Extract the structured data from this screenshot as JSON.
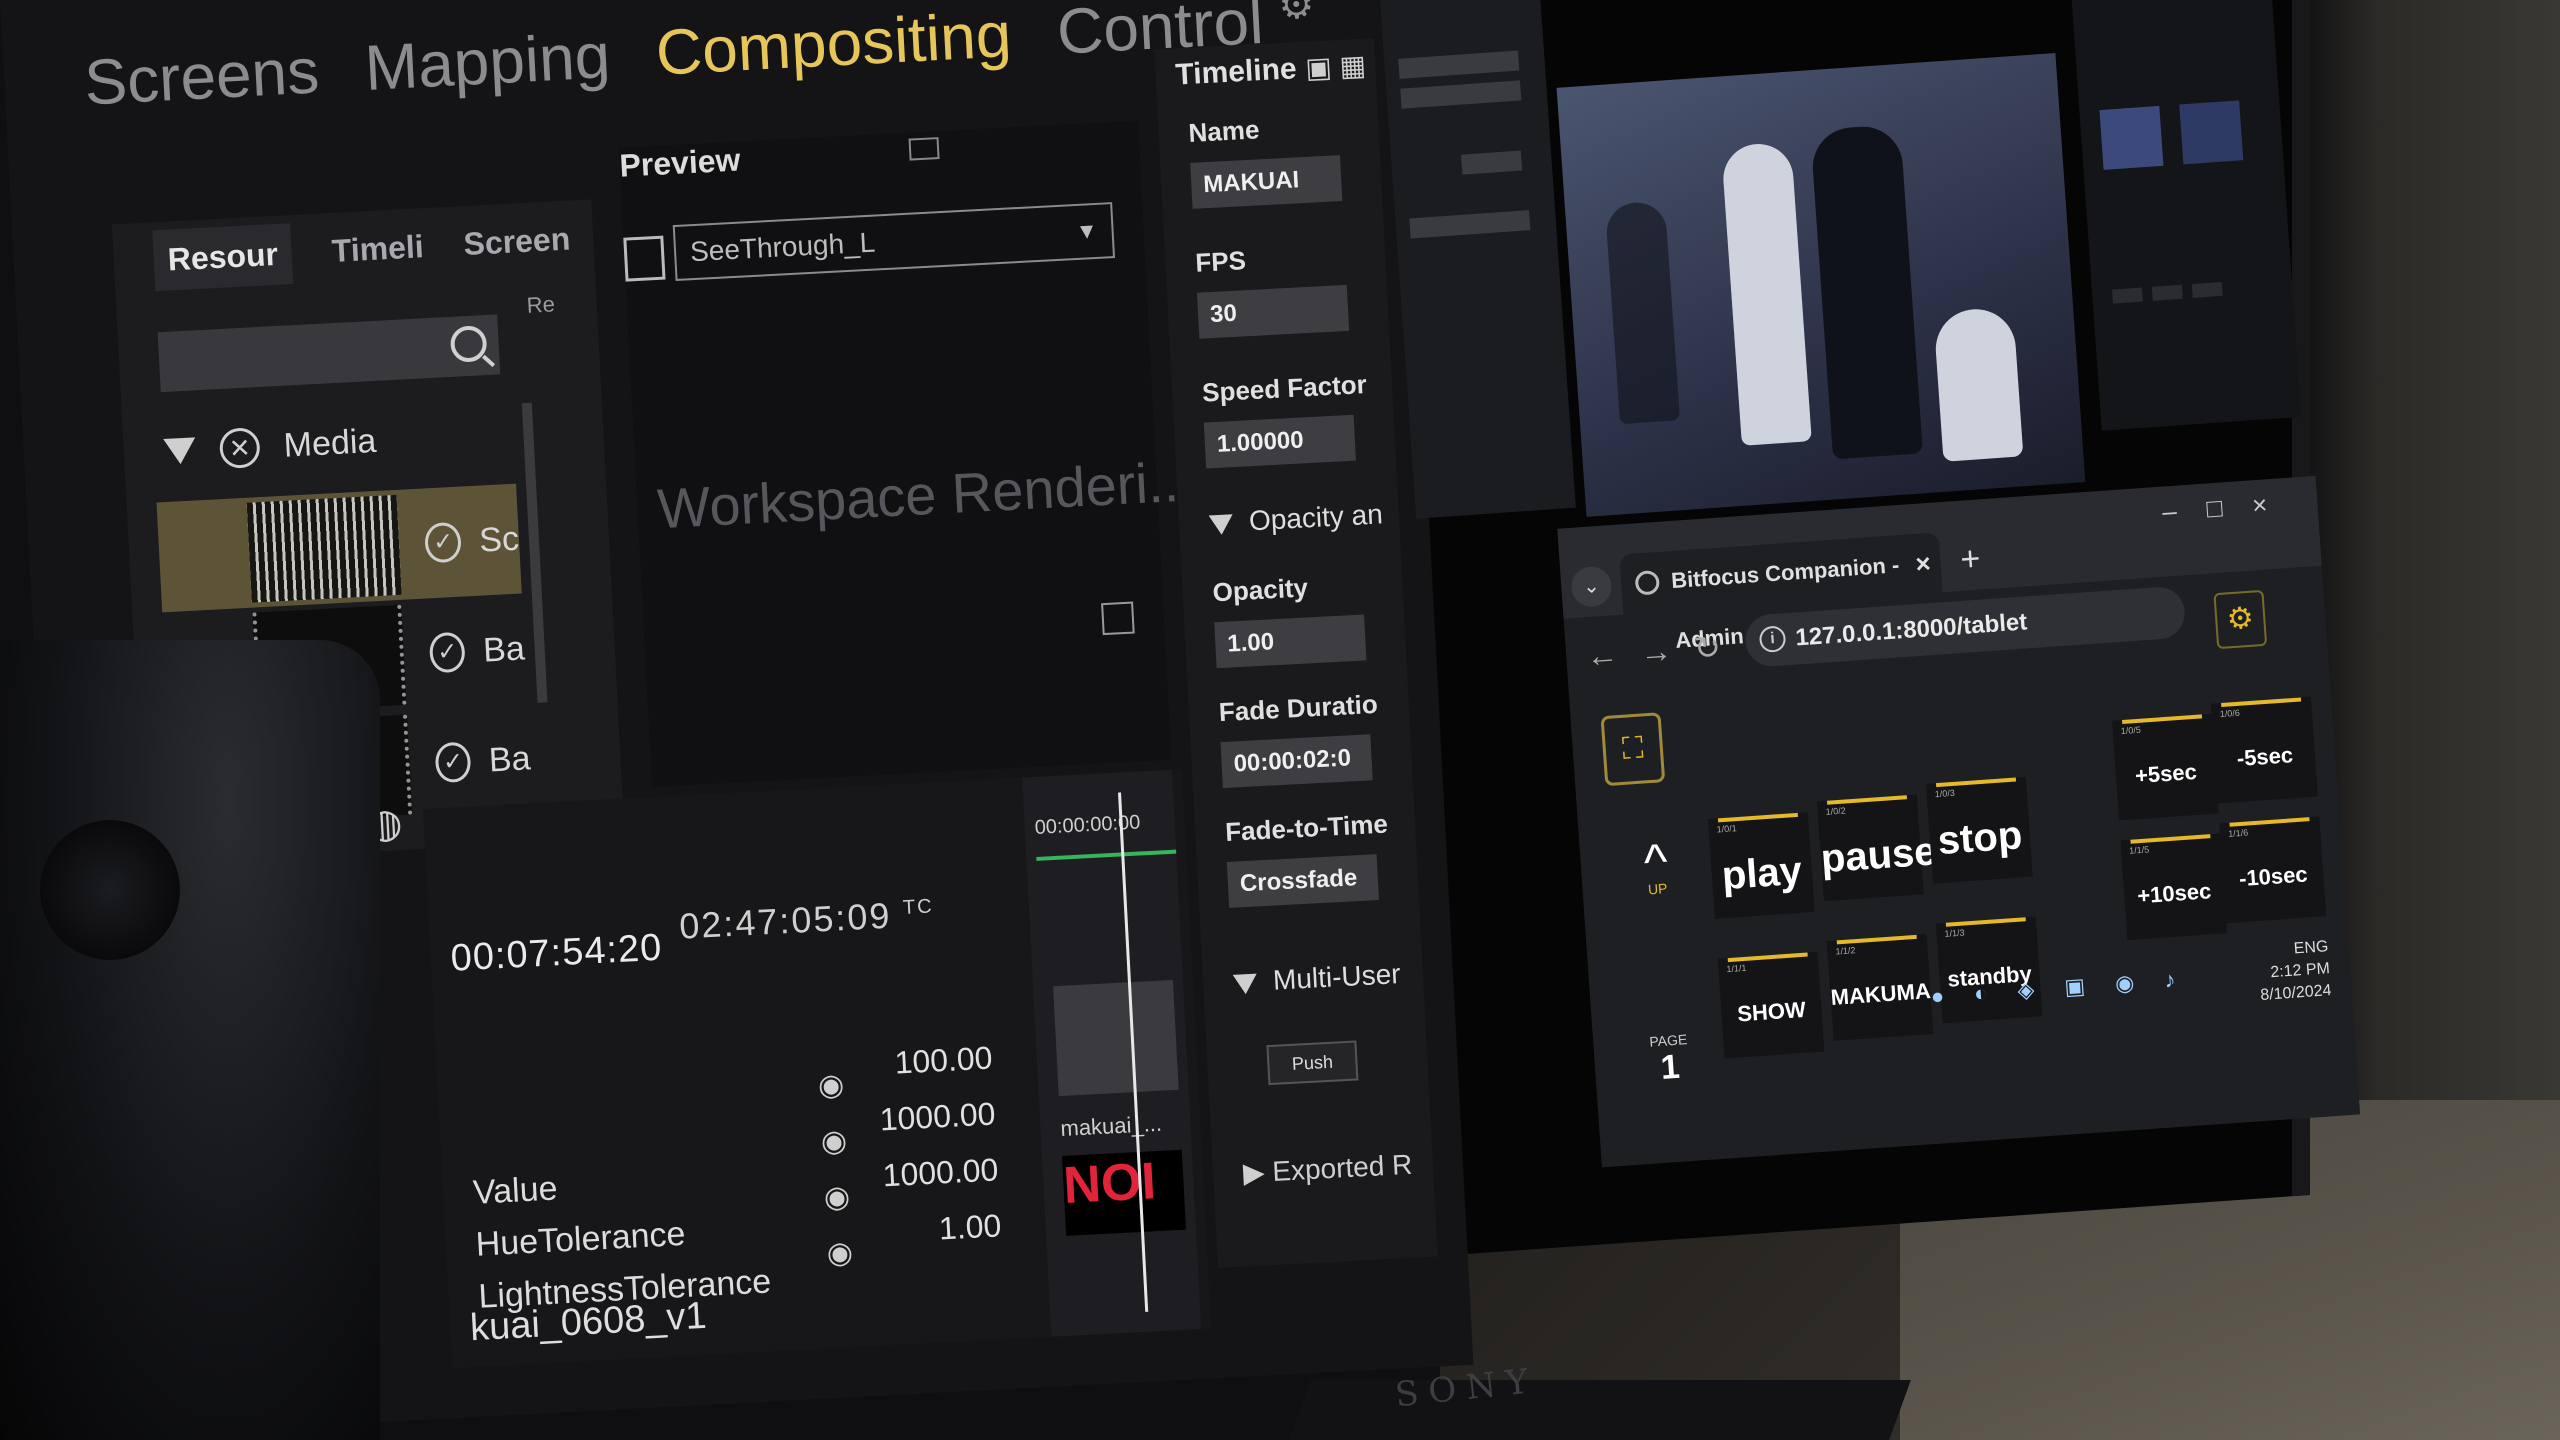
{
  "compositing_app": {
    "top_tabs": [
      "Screens",
      "Mapping",
      "Compositing",
      "Control"
    ],
    "active_tab": "Compositing",
    "sub_tabs": [
      "Resour",
      "Timeli",
      "Screen"
    ],
    "resources_stub": "Re",
    "media_folder": "Media",
    "media_items": [
      {
        "label": "Sc",
        "thumb": "Pozo"
      },
      {
        "label": "Ba"
      },
      {
        "label": "Ba"
      }
    ],
    "preview": {
      "title": "Preview",
      "selected_source": "SeeThrough_L",
      "status": "Workspace Renderi..."
    },
    "timeline": {
      "current_time": "00:07:54:20",
      "timecode": "02:47:05:09",
      "tc_label": "TC",
      "track_time": "00:00:00:00",
      "values": [
        "100.00",
        "1000.00",
        "1000.00",
        "1.00"
      ],
      "params": [
        "Value",
        "HueTolerance",
        "LightnessTolerance"
      ],
      "clip_name": "kuai_0608_v1",
      "track_clip_label": "makuai_...",
      "noi_logo": "NOI"
    },
    "properties": {
      "header": "Timeline",
      "name_label": "Name",
      "name_value": "MAKUAI",
      "fps_label": "FPS",
      "fps_value": "30",
      "speed_label": "Speed Factor",
      "speed_value": "1.00000",
      "opacity_section": "Opacity an",
      "opacity_label": "Opacity",
      "opacity_value": "1.00",
      "fade_label": "Fade Duratio",
      "fade_value": "00:00:02:0",
      "fade_to_label": "Fade-to-Time",
      "fade_to_value": "Crossfade",
      "multi_user": "Multi-User",
      "push": "Push",
      "exported": "Exported R"
    }
  },
  "companion": {
    "tab_title": "Bitfocus Companion - Admin",
    "url": "127.0.0.1:8000/tablet",
    "keys": [
      {
        "id": "play",
        "label": "play",
        "tag": "1/0/1"
      },
      {
        "id": "pause",
        "label": "pause",
        "tag": "1/0/2"
      },
      {
        "id": "stop",
        "label": "stop",
        "tag": "1/0/3"
      },
      {
        "id": "plus5",
        "label": "+5sec",
        "tag": "1/0/5"
      },
      {
        "id": "minus5",
        "label": "-5sec",
        "tag": "1/0/6"
      },
      {
        "id": "plus10",
        "label": "+10sec",
        "tag": "1/1/5"
      },
      {
        "id": "minus10",
        "label": "-10sec",
        "tag": "1/1/6"
      },
      {
        "id": "show",
        "label": "SHOW",
        "tag": "1/1/1"
      },
      {
        "id": "makuma",
        "label": "MAKUMA",
        "tag": "1/1/2"
      },
      {
        "id": "standby",
        "label": "standby",
        "tag": "1/1/3"
      }
    ],
    "up_label": "UP",
    "page_label": "PAGE",
    "page_number": "1",
    "clock_time": "2:12 PM",
    "clock_date": "8/10/2024",
    "lang": "ENG"
  },
  "monitor_brand": "SONY",
  "colors": {
    "accent_yellow": "#e6c65a",
    "companion_gold": "#e6b92b",
    "selected_item": "#5d5438"
  }
}
